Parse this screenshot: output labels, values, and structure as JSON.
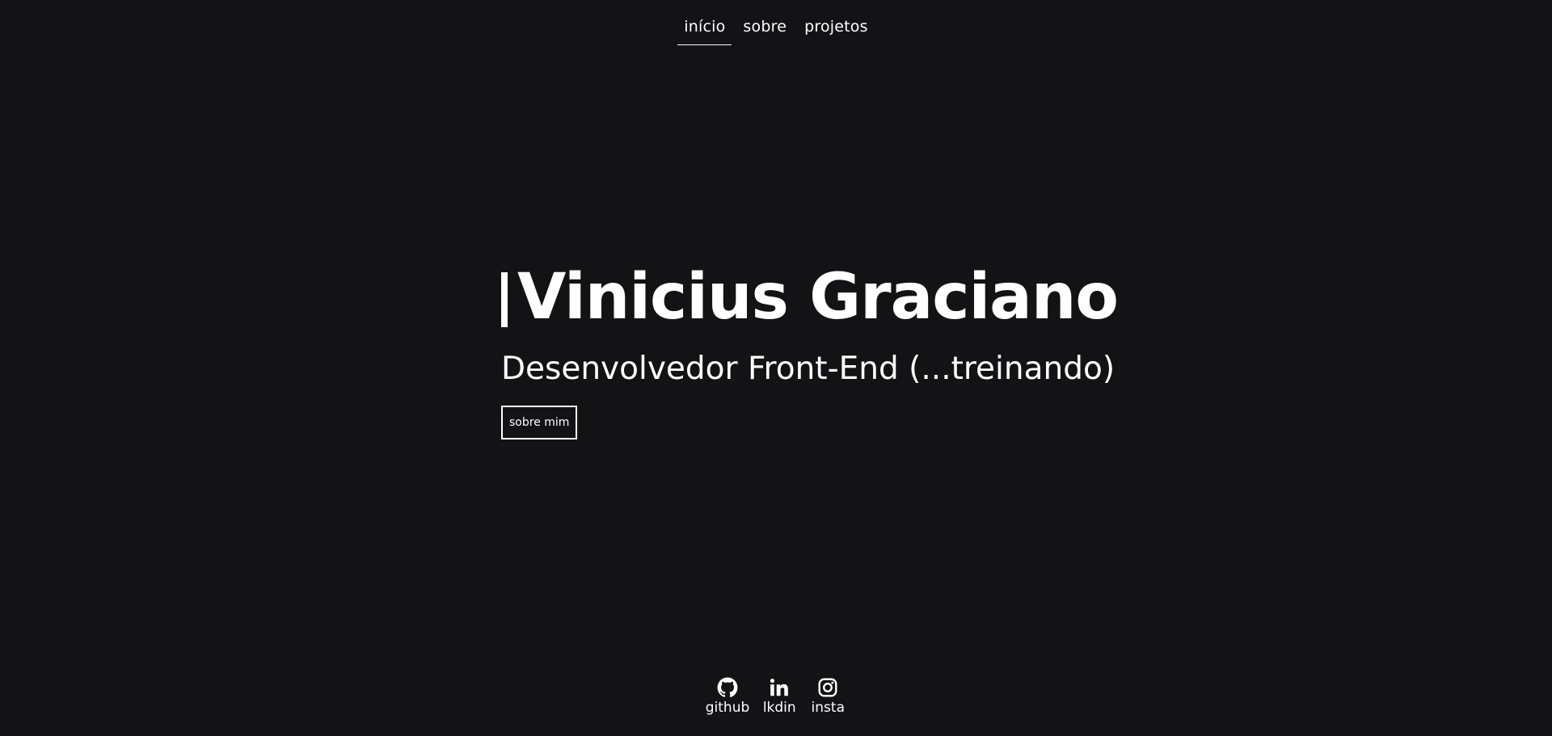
{
  "nav": {
    "items": [
      {
        "label": "início",
        "active": true
      },
      {
        "label": "sobre",
        "active": false
      },
      {
        "label": "projetos",
        "active": false
      }
    ]
  },
  "hero": {
    "title": "Vinicius Graciano",
    "subtitle": "Desenvolvedor Front-End (...treinando)",
    "button_label": "sobre mim"
  },
  "social": {
    "items": [
      {
        "label": "github",
        "icon": "github-icon"
      },
      {
        "label": "lkdin",
        "icon": "linkedin-icon"
      },
      {
        "label": "insta",
        "icon": "instagram-icon"
      }
    ]
  },
  "colors": {
    "background": "#131315",
    "text": "#ffffff"
  }
}
